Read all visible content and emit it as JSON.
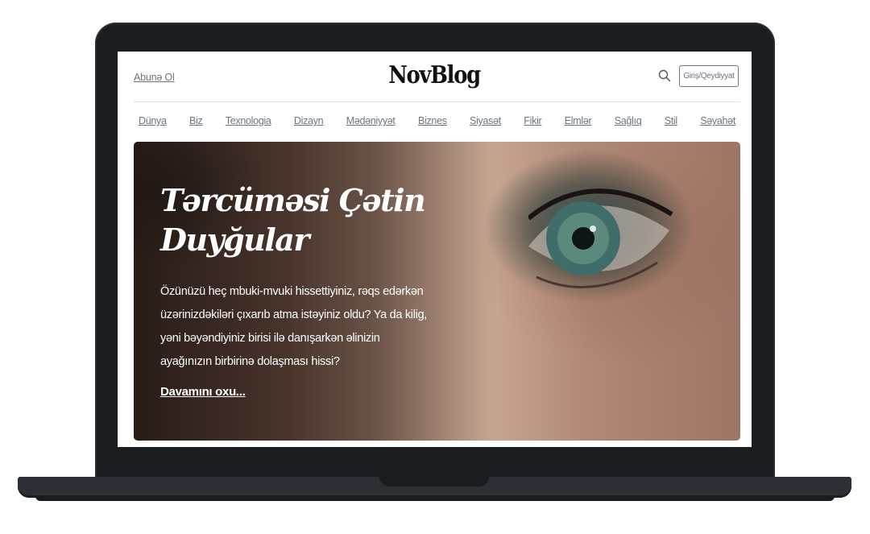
{
  "header": {
    "subscribe_label": "Abunə Ol",
    "logo": "NovBlog",
    "search_icon": "search-icon",
    "login_label": "Giriş/Qeydiyyat"
  },
  "nav": {
    "items": [
      "Dünya",
      "Biz",
      "Texnologia",
      "Dizayn",
      "Mədəniyyət",
      "Biznes",
      "Siyasət",
      "Fikir",
      "Elmlər",
      "Sağlıq",
      "Stil",
      "Səyahət"
    ]
  },
  "hero": {
    "title_line1": "Tərcüməsi Çətin",
    "title_line2": "Duyğular",
    "body": "Özünüzü heç mbuki-mvuki hissettiyiniz, rəqs edərkən üzərinizdəkiləri çıxarıb atma istəyiniz oldu? Ya da kilig, yəni bəyəndiyiniz birisi ilə danışarkən əlinizin ayağınızın birbirinə dolaşması hissi?",
    "read_more": "Davamını oxu..."
  },
  "colors": {
    "laptop_frame": "#1b1e21",
    "muted_text": "#6c757d",
    "logo_text": "#111111"
  }
}
